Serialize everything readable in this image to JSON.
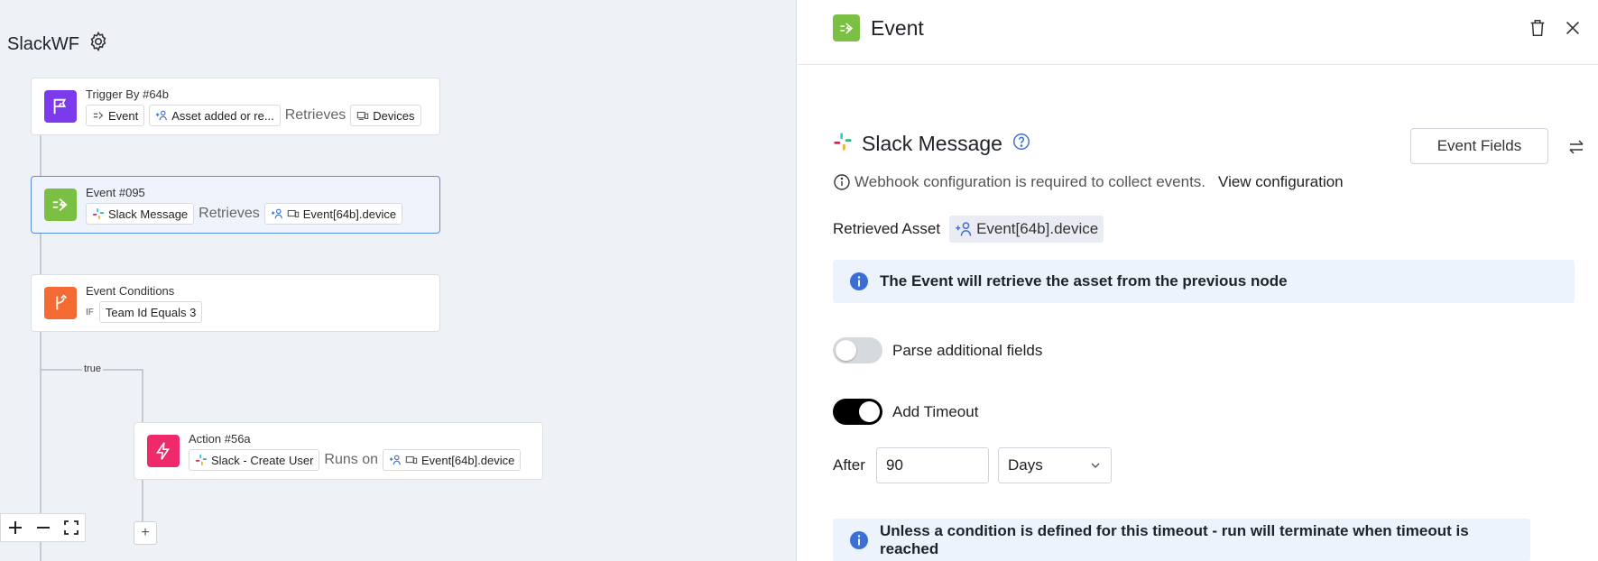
{
  "workflow": {
    "title": "SlackWF"
  },
  "canvas": {
    "nodes": {
      "trigger": {
        "title": "Trigger By #64b",
        "chip_event": "Event",
        "chip_asset": "Asset added or re...",
        "retrieves_label": "Retrieves",
        "chip_devices": "Devices",
        "icon_color": "#7c3aed"
      },
      "event": {
        "title": "Event #095",
        "chip_source": "Slack Message",
        "retrieves_label": "Retrieves",
        "chip_device": "Event[64b].device",
        "icon_color": "#7bc043"
      },
      "conditions": {
        "title": "Event Conditions",
        "if_label": "IF",
        "chip_condition": "Team Id Equals 3",
        "icon_color": "#f36a32"
      },
      "action": {
        "title": "Action #56a",
        "chip_action": "Slack - Create User",
        "runs_on_label": "Runs on",
        "chip_device": "Event[64b].device",
        "icon_color": "#ee2a6b"
      }
    },
    "branch_label": "true",
    "add_node_label": "+",
    "zoom_controls": [
      "zoom-in-icon",
      "zoom-out-icon",
      "fit-screen-icon"
    ]
  },
  "panel": {
    "header": {
      "title": "Event",
      "icon": "event-icon"
    },
    "source": {
      "title": "Slack Message",
      "event_fields_label": "Event Fields"
    },
    "webhook": {
      "note": "Webhook configuration is required to collect events.",
      "link_label": "View configuration"
    },
    "retrieved_asset": {
      "label": "Retrieved Asset",
      "value": "Event[64b].device"
    },
    "info_retrieve": "The Event will retrieve the asset from the previous node",
    "parse_fields": {
      "label": "Parse additional fields",
      "enabled": false
    },
    "add_timeout": {
      "label": "Add Timeout",
      "enabled": true
    },
    "timeout": {
      "after_label": "After",
      "value": "90",
      "unit": "Days"
    },
    "info_timeout": "Unless a condition is defined for this timeout - run will terminate when timeout is reached"
  },
  "colors": {
    "accent_blue": "#3b6fd4",
    "info_bg": "#ecf3fd",
    "canvas_bg": "#eef1f5"
  }
}
